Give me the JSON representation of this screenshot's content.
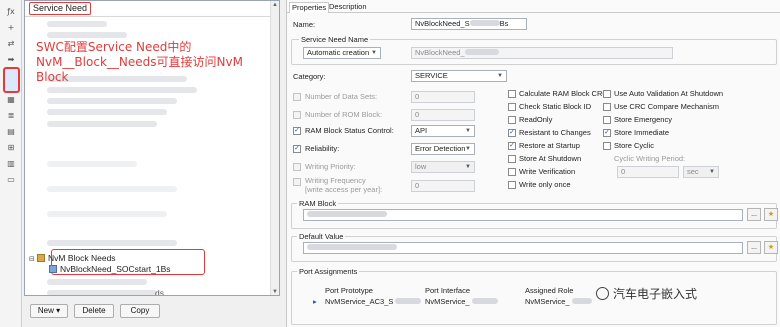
{
  "strip": {
    "icons": [
      "fx-icon",
      "add-icon",
      "link-icon",
      "arrow-icon",
      "service-needs-icon",
      "grid-icon",
      "list-icon",
      "stack-icon",
      "tree-icon",
      "stack2-icon",
      "doc-icon"
    ],
    "glyphs": {
      "fx": "ƒx",
      "add": "+",
      "link": "⇄",
      "arrow": "➡",
      "grid": "▦",
      "list": "≣",
      "stack": "▤",
      "tree": "⊞",
      "stack2": "▥",
      "doc": "▭"
    }
  },
  "tree": {
    "header": "Service Need",
    "callout": "SWC配置Service  Need中的NvM__Block__Needs可直接访问NvM  Block",
    "group_label": "NvM Block Needs",
    "item_label": "NvBlockNeed_SOCstart_1Bs",
    "partial_right_text": "ds",
    "partial_right_text2": "ds",
    "twist": "⊟"
  },
  "buttons": {
    "new": "New",
    "new_arrow": "▾",
    "delete": "Delete",
    "copy": "Copy"
  },
  "props": {
    "tabs": {
      "properties": "Properties",
      "description": "Description"
    },
    "name_label": "Name:",
    "name_value": "NvBlockNeed_S",
    "name_value_suffix": "Bs",
    "service_need_name": {
      "label": "Service Need Name",
      "mode": "Automatic creation",
      "value": "NvBlockNeed_"
    },
    "category_label": "Category:",
    "category_value": "SERVICE",
    "left_options": [
      {
        "label": "Number of Data Sets:",
        "value": "0",
        "checked": false,
        "enabled": false
      },
      {
        "label": "Number of ROM Block:",
        "value": "0",
        "checked": false,
        "enabled": false
      },
      {
        "label": "RAM Block Status Control:",
        "value": "API",
        "checked": true,
        "enabled": true
      },
      {
        "label": "Reliability:",
        "value": "Error Detection",
        "checked": true,
        "enabled": true
      },
      {
        "label": "Writing Priority:",
        "value": "low",
        "checked": false,
        "enabled": false
      },
      {
        "label": "Writing Frequency\n[write access per year]:",
        "value": "0",
        "checked": false,
        "enabled": false
      }
    ],
    "mid_options": [
      {
        "label": "Calculate RAM Block CRC",
        "checked": false
      },
      {
        "label": "Check Static Block ID",
        "checked": false
      },
      {
        "label": "ReadOnly",
        "checked": false
      },
      {
        "label": "Resistant to Changes",
        "checked": true
      },
      {
        "label": "Restore at Startup",
        "checked": true
      },
      {
        "label": "Store At Shutdown",
        "checked": false
      },
      {
        "label": "Write Verification",
        "checked": false
      },
      {
        "label": "Write only once",
        "checked": false
      }
    ],
    "right_options": [
      {
        "label": "Use Auto Validation At Shutdown",
        "checked": false
      },
      {
        "label": "Use CRC Compare Mechanism",
        "checked": false
      },
      {
        "label": "Store Emergency",
        "checked": false
      },
      {
        "label": "Store Immediate",
        "checked": true
      },
      {
        "label": "Store Cyclic",
        "checked": false
      }
    ],
    "cyclic_period_label": "Cyclic Writing Period:",
    "cyclic_period_value": "0",
    "cyclic_unit": "sec",
    "ram_block_label": "RAM Block",
    "default_value_label": "Default Value",
    "ellipsis": "...",
    "port_assign_label": "Port Assignments",
    "port_table": {
      "headers": [
        "Port Prototype",
        "Port Interface",
        "Assigned Role"
      ],
      "row": [
        "NvMService_AC3_S",
        "NvMService_",
        "NvMService_"
      ],
      "marker": "▸"
    },
    "watermark": "汽车电子嵌入式"
  },
  "colors": {
    "highlight": "#e23b3b",
    "accent": "#2b5d9c"
  }
}
